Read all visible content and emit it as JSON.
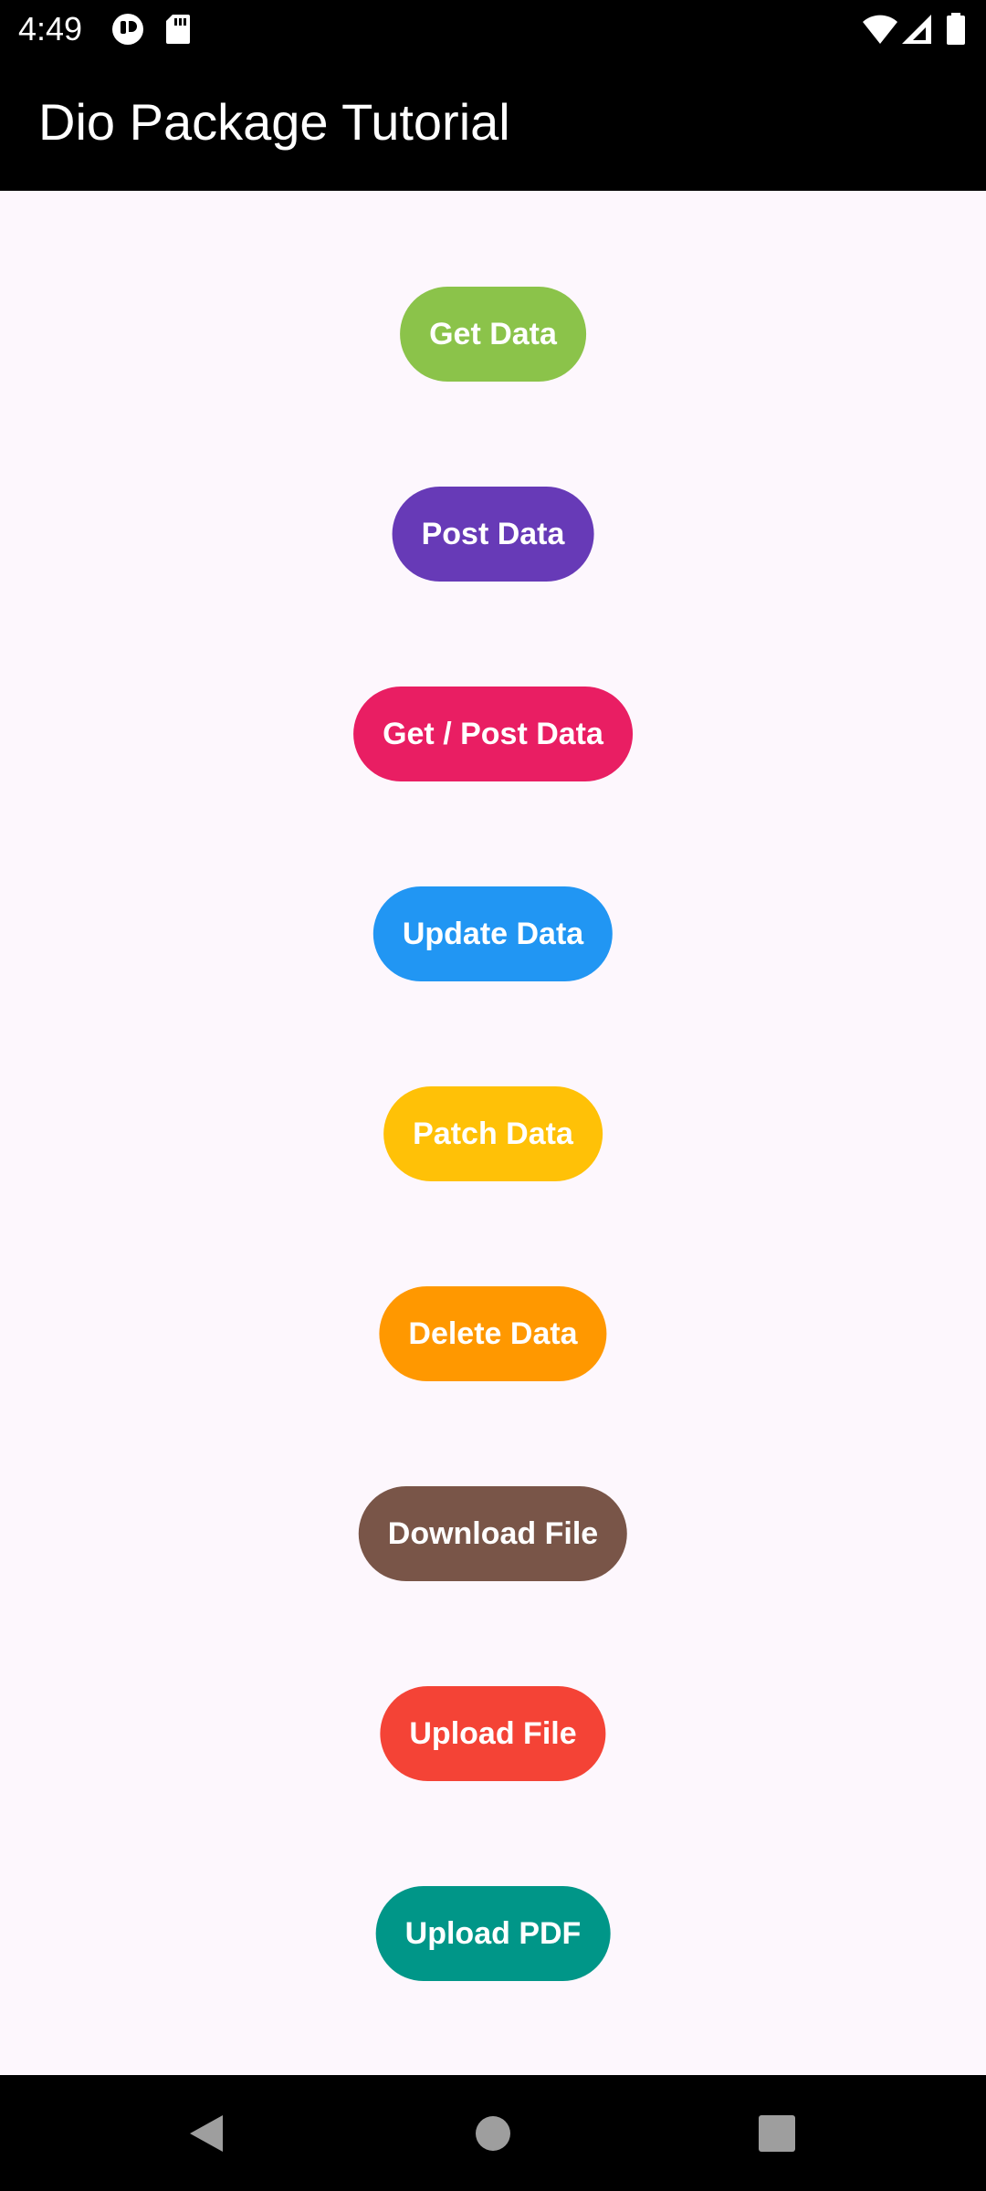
{
  "status_bar": {
    "time": "4:49",
    "left_icons": [
      "app-notification-icon",
      "sd-card-icon"
    ],
    "right_icons": [
      "wifi-icon",
      "cell-signal-icon",
      "battery-icon"
    ]
  },
  "app_bar": {
    "title": "Dio Package Tutorial"
  },
  "buttons": [
    {
      "label": "Get Data",
      "color": "#8bc34a"
    },
    {
      "label": "Post Data",
      "color": "#673ab7"
    },
    {
      "label": "Get / Post Data",
      "color": "#e91e63"
    },
    {
      "label": "Update Data",
      "color": "#2196f3"
    },
    {
      "label": "Patch Data",
      "color": "#ffc107"
    },
    {
      "label": "Delete Data",
      "color": "#ff9800"
    },
    {
      "label": "Download File",
      "color": "#795548"
    },
    {
      "label": "Upload File",
      "color": "#f44336"
    },
    {
      "label": "Upload PDF",
      "color": "#009688"
    }
  ],
  "nav_bar": {
    "icons": [
      "back-icon",
      "home-icon",
      "recents-icon"
    ]
  },
  "colors": {
    "background": "#fdf7fd",
    "app_bar": "#000000",
    "text_on_button": "#ffffff"
  }
}
